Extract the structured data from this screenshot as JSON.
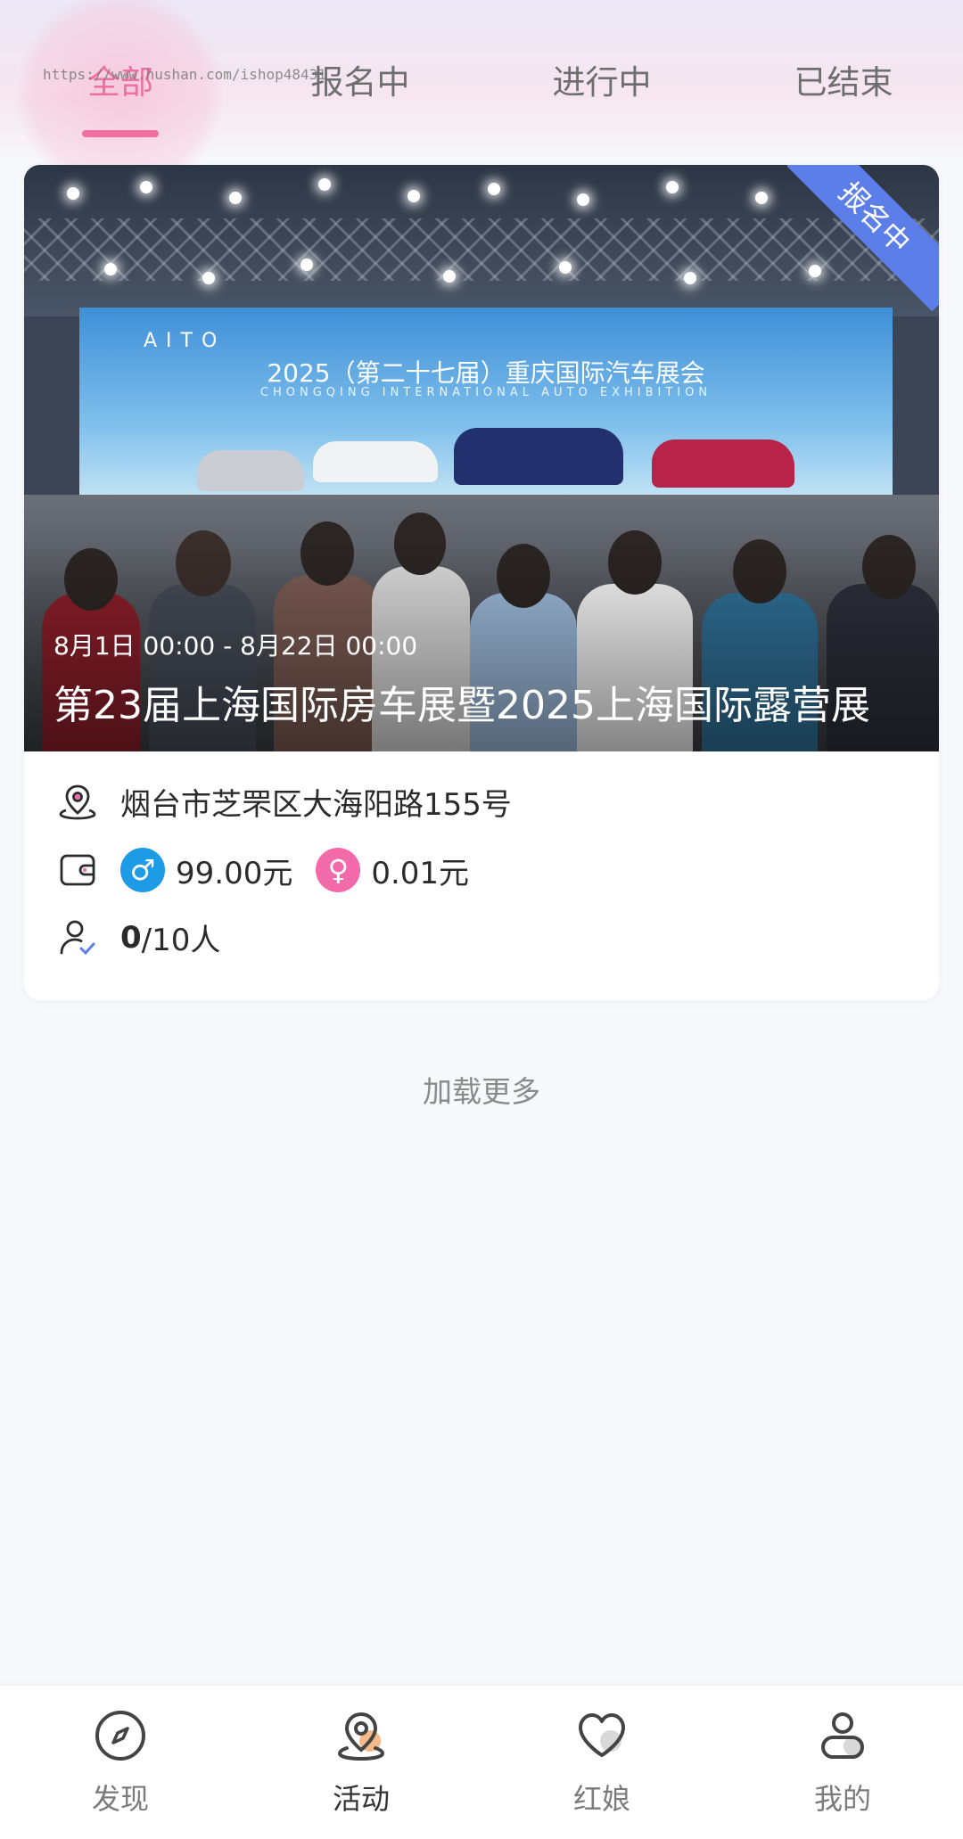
{
  "watermark": "https://www.hushan.com/ishop48431",
  "tabs": [
    {
      "label": "全部",
      "active": true
    },
    {
      "label": "报名中",
      "active": false
    },
    {
      "label": "进行中",
      "active": false
    },
    {
      "label": "已结束",
      "active": false
    }
  ],
  "event": {
    "status_badge": "报名中",
    "date_range": "8月1日 00:00 - 8月22日 00:00",
    "title": "第23届上海国际房车展暨2025上海国际露营展",
    "cover": {
      "brand": "AITO",
      "screen_title": "2025（第二十七届）重庆国际汽车展会",
      "screen_subtitle": "CHONGQING INTERNATIONAL AUTO EXHIBITION"
    },
    "address": "烟台市芝罘区大海阳路155号",
    "male_price": "99.00元",
    "female_price": "0.01元",
    "male_symbol": "♂",
    "female_symbol": "♀",
    "enrolled": "0",
    "capacity": "/10人"
  },
  "load_more": "加载更多",
  "bottom_nav": [
    {
      "label": "发现",
      "icon": "compass-icon"
    },
    {
      "label": "活动",
      "icon": "location-pin-icon",
      "active": true
    },
    {
      "label": "红娘",
      "icon": "heart-icon"
    },
    {
      "label": "我的",
      "icon": "user-icon"
    }
  ],
  "colors": {
    "accent_pink": "#ef6fa0",
    "badge_blue": "#5b7ee8",
    "male_blue": "#1e9be6",
    "female_pink": "#f26aa9",
    "nav_accent_orange": "#f7b98a"
  }
}
